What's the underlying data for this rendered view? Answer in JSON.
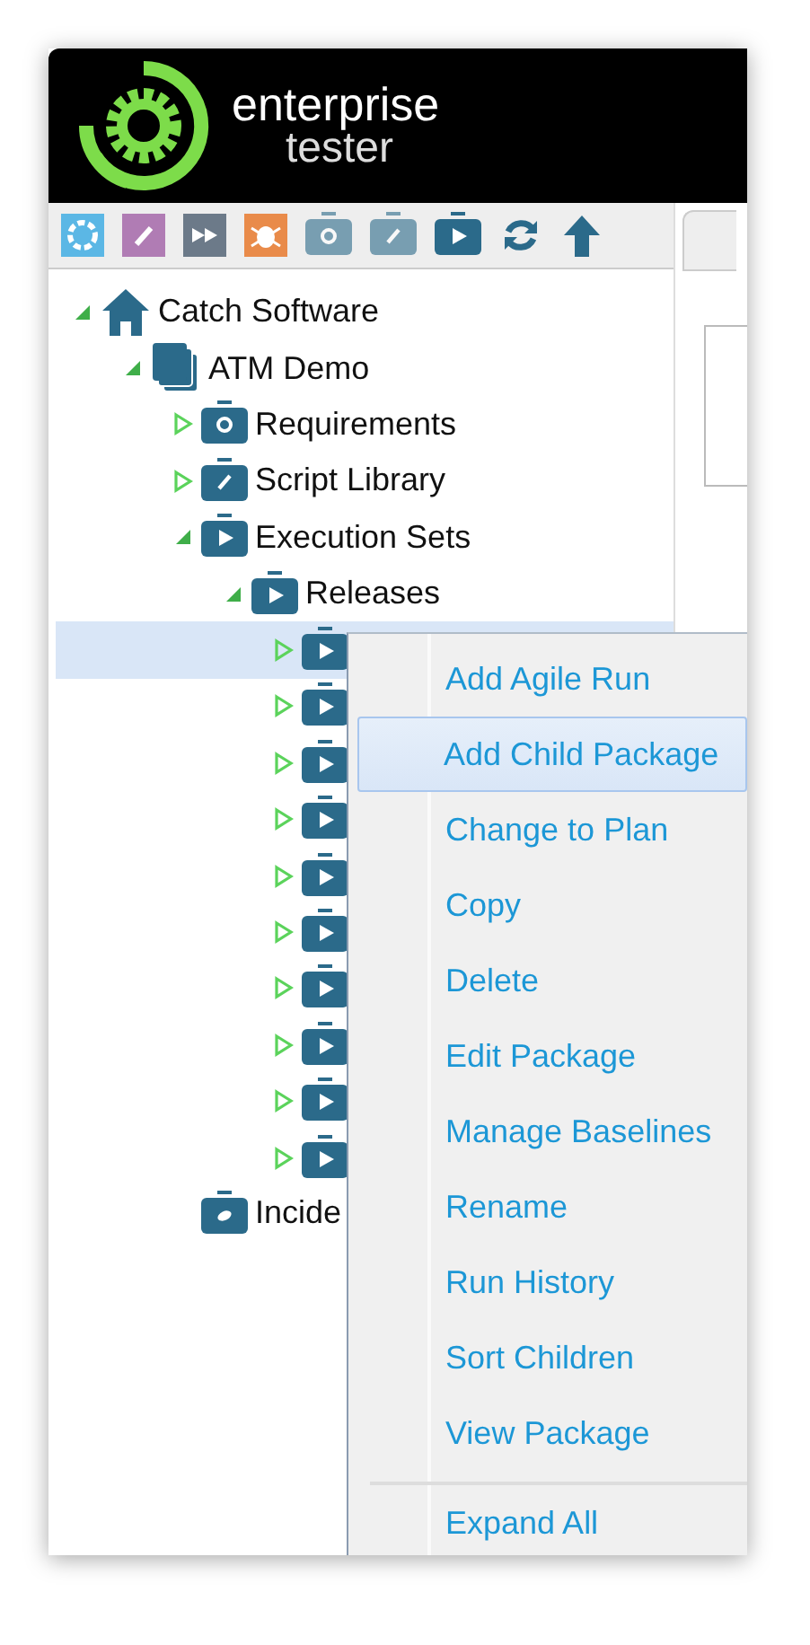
{
  "logo": {
    "line_1": "enterprise",
    "line_2": "tester"
  },
  "toolbar": [
    {
      "kind": "requirement",
      "disabled": false
    },
    {
      "kind": "script",
      "disabled": false
    },
    {
      "kind": "execution",
      "disabled": false
    },
    {
      "kind": "incident",
      "disabled": false
    },
    {
      "kind": "requirement-folder",
      "disabled": true
    },
    {
      "kind": "script-folder",
      "disabled": true
    },
    {
      "kind": "execution-folder",
      "disabled": false
    },
    {
      "kind": "refresh",
      "disabled": false
    },
    {
      "kind": "up",
      "disabled": false
    }
  ],
  "tree": [
    {
      "label": "Catch Software",
      "kind": "home",
      "expanded": true,
      "selected": false,
      "children": [
        {
          "label": "ATM Demo",
          "kind": "project",
          "expanded": true,
          "selected": false,
          "children": [
            {
              "label": "Requirements",
              "kind": "requirements",
              "expanded": false,
              "selected": false
            },
            {
              "label": "Script Library",
              "kind": "scripts",
              "expanded": false,
              "selected": false
            },
            {
              "label": "Execution Sets",
              "kind": "execution",
              "expanded": true,
              "selected": false,
              "children": [
                {
                  "label": "Releases",
                  "kind": "execution",
                  "expanded": true,
                  "selected": false,
                  "children": [
                    {
                      "kind": "execution",
                      "expanded": false,
                      "selected": true
                    },
                    {
                      "kind": "execution",
                      "expanded": false,
                      "selected": false
                    },
                    {
                      "kind": "execution",
                      "expanded": false,
                      "selected": false
                    },
                    {
                      "kind": "execution",
                      "expanded": false,
                      "selected": false
                    },
                    {
                      "kind": "execution",
                      "expanded": false,
                      "selected": false
                    },
                    {
                      "kind": "execution",
                      "expanded": false,
                      "selected": false
                    },
                    {
                      "kind": "execution",
                      "expanded": false,
                      "selected": false
                    },
                    {
                      "kind": "execution",
                      "expanded": false,
                      "selected": false
                    },
                    {
                      "kind": "execution",
                      "expanded": false,
                      "selected": false
                    },
                    {
                      "kind": "execution",
                      "expanded": false,
                      "selected": false
                    }
                  ]
                }
              ]
            },
            {
              "label": "Incide",
              "kind": "incidents",
              "selected": false
            }
          ]
        }
      ]
    }
  ],
  "context_menu": {
    "groups": [
      [
        {
          "label": "Add Agile Run",
          "selected": false
        },
        {
          "label": "Add Child Package",
          "selected": true
        },
        {
          "label": "Change to Plan",
          "selected": false
        },
        {
          "label": "Copy",
          "selected": false
        },
        {
          "label": "Delete",
          "selected": false
        },
        {
          "label": "Edit Package",
          "selected": false
        },
        {
          "label": "Manage Baselines",
          "selected": false
        },
        {
          "label": "Rename",
          "selected": false
        },
        {
          "label": "Run History",
          "selected": false
        },
        {
          "label": "Sort Children",
          "selected": false
        },
        {
          "label": "View Package",
          "selected": false
        }
      ],
      [
        {
          "label": "Expand All",
          "selected": false
        }
      ]
    ]
  }
}
